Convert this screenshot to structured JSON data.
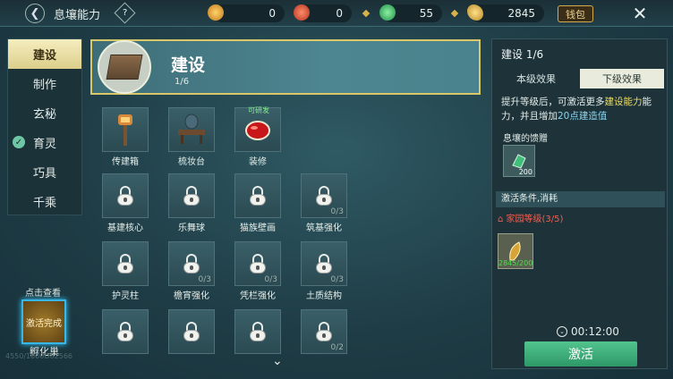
{
  "topbar": {
    "title": "息壤能力",
    "help": "?",
    "resources": [
      {
        "icon": "flame-token-icon",
        "value": "0"
      },
      {
        "icon": "red-ore-icon",
        "value": "0"
      },
      {
        "icon": "green-jade-icon",
        "value": "55"
      },
      {
        "icon": "gold-feather-icon",
        "value": "2845"
      }
    ],
    "money_label": "钱包"
  },
  "nav": {
    "items": [
      {
        "label": "建设",
        "active": true
      },
      {
        "label": "制作"
      },
      {
        "label": "玄秘"
      },
      {
        "label": "育灵",
        "checked": true
      },
      {
        "label": "巧具"
      },
      {
        "label": "千乘"
      }
    ]
  },
  "sidebar": {
    "hint": "点击查看",
    "activate_done": "激活完成",
    "hatch": "孵化巢",
    "faint_text": "4550/1000D82566"
  },
  "category": {
    "name": "建设",
    "count": "1/6"
  },
  "grid": {
    "row1": [
      {
        "label": "传建箱",
        "icon": "lantern-post-icon"
      },
      {
        "label": "梳妆台",
        "icon": "vanity-table-icon"
      },
      {
        "label": "装修",
        "icon": "red-orb-icon",
        "badge": "可研发"
      }
    ],
    "row2": [
      {
        "label": "基建核心",
        "progress": ""
      },
      {
        "label": "乐舞球",
        "progress": ""
      },
      {
        "label": "猫族壁画",
        "progress": ""
      },
      {
        "label": "筑基强化",
        "progress": "0/3"
      }
    ],
    "row3": [
      {
        "label": "护灵柱",
        "progress": ""
      },
      {
        "label": "檐宵强化",
        "progress": "0/3"
      },
      {
        "label": "凭栏强化",
        "progress": "0/3"
      },
      {
        "label": "土质结构",
        "progress": "0/3"
      }
    ],
    "row4": [
      {
        "label": "",
        "progress": ""
      },
      {
        "label": "",
        "progress": ""
      },
      {
        "label": "",
        "progress": ""
      },
      {
        "label": "",
        "progress": "0/2"
      }
    ]
  },
  "panel": {
    "title": "建设 1/6",
    "tabs": [
      "本级效果",
      "下级效果"
    ],
    "desc_pre": "提升等级后，可激活更多",
    "desc_hl": "建设能力",
    "desc_mid": "能力，并且增加",
    "desc_hl2": "20点建造值",
    "material_title": "息壤的馈赠",
    "material_count": "200",
    "cond_title": "激活条件,消耗",
    "cond": "家园等级(3/5)",
    "cost_count": "2845/200",
    "timer": "00:12:00",
    "activate": "激活"
  }
}
